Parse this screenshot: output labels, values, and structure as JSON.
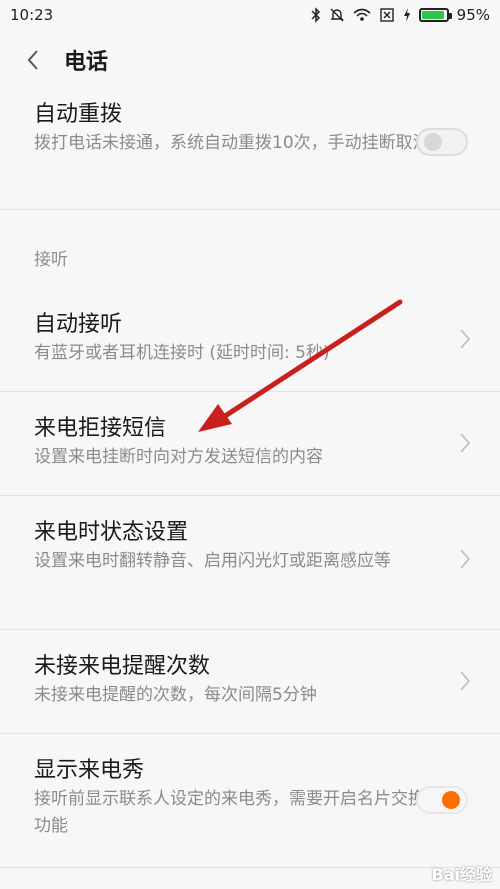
{
  "status": {
    "time": "10:23",
    "battery_text": "95%",
    "battery_level": 0.95,
    "icons": [
      "bluetooth-icon",
      "mute-bell-icon",
      "wifi-icon",
      "sim-x-icon",
      "charging-icon",
      "battery-icon"
    ]
  },
  "appbar": {
    "title": "电话"
  },
  "rows": {
    "auto_redial": {
      "title": "自动重拨",
      "desc": "拨打电话未接通，系统自动重拨10次，手动挂断取消",
      "toggle_on": false
    },
    "section_answer": "接听",
    "auto_answer": {
      "title": "自动接听",
      "desc": "有蓝牙或者耳机连接时 (延时时间: 5秒)"
    },
    "reject_sms": {
      "title": "来电拒接短信",
      "desc": "设置来电挂断时向对方发送短信的内容"
    },
    "call_state": {
      "title": "来电时状态设置",
      "desc": "设置来电时翻转静音、启用闪光灯或距离感应等"
    },
    "missed_reminder": {
      "title": "未接来电提醒次数",
      "desc": "未接来电提醒的次数，每次间隔5分钟"
    },
    "caller_show": {
      "title": "显示来电秀",
      "desc": "接听前显示联系人设定的来电秀，需要开启名片交换功能",
      "toggle_on": true
    }
  },
  "colors": {
    "accent": "#ff6e00",
    "arrow": "#c8201e",
    "battery": "#33c24a"
  },
  "watermark": "Bai经验"
}
